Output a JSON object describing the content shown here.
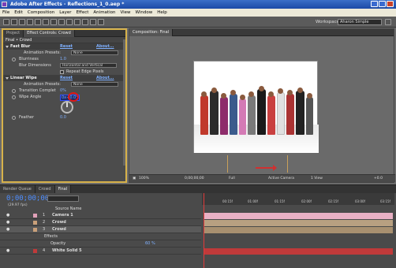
{
  "window": {
    "title": "Adobe After Effects - Reflections_1_0.aep *"
  },
  "menu": [
    "File",
    "Edit",
    "Composition",
    "Layer",
    "Effect",
    "Animation",
    "View",
    "Window",
    "Help"
  ],
  "toolbar": {
    "workspace_label": "Workspace:",
    "workspace_value": "Aharon Simple"
  },
  "left_panel": {
    "tabs": [
      "Project",
      "Effect Controls: Crowd"
    ],
    "header": "Final • Crowd",
    "fast_blur": {
      "name": "Fast Blur",
      "reset": "Reset",
      "about": "About...",
      "presets_label": "Animation Presets:",
      "presets_value": "None",
      "blurriness_label": "Blurriness",
      "blurriness_value": "1.0",
      "dimensions_label": "Blur Dimensions",
      "dimensions_value": "Horizontal and Vertical",
      "repeat_label": "Repeat Edge Pixels"
    },
    "linear_wipe": {
      "name": "Linear Wipe",
      "reset": "Reset",
      "about": "About...",
      "presets_label": "Animation Presets:",
      "presets_value": "None",
      "transition_label": "Transition Complet",
      "transition_value": "0%",
      "angle_label": "Wipe Angle",
      "angle_value": "0x+0.0°",
      "feather_label": "Feather",
      "feather_value": "0.0"
    }
  },
  "comp_panel": {
    "tab": "Composition: Final",
    "footer": {
      "zoom": "100%",
      "time": "0;00;00;00",
      "quality": "Full",
      "camera": "Active Camera",
      "views": "1 View",
      "exposure": "+0.0"
    }
  },
  "timeline": {
    "tabs": [
      "Render Queue",
      "Crowd",
      "Final"
    ],
    "time": "0;00;00;00",
    "fps": "(29.97 fps)",
    "column_header": "Source Name",
    "layers": [
      {
        "num": "1",
        "name": "Camera 1",
        "color": "#e0a0b8"
      },
      {
        "num": "2",
        "name": "Crowd",
        "color": "#c9a07a"
      },
      {
        "num": "3",
        "name": "Crowd",
        "color": "#c9a07a"
      },
      {
        "num": "",
        "name": "Effects",
        "color": ""
      },
      {
        "num": "",
        "name": "Opacity",
        "value": "60 %",
        "color": ""
      },
      {
        "num": "4",
        "name": "White Solid 5",
        "color": "#c03a3a"
      }
    ],
    "ruler_ticks": [
      "00:15f",
      "01:00f",
      "01:15f",
      "02:00f",
      "02:15f",
      "03:00f",
      "03:15f"
    ],
    "accent": "#4d8dff"
  }
}
